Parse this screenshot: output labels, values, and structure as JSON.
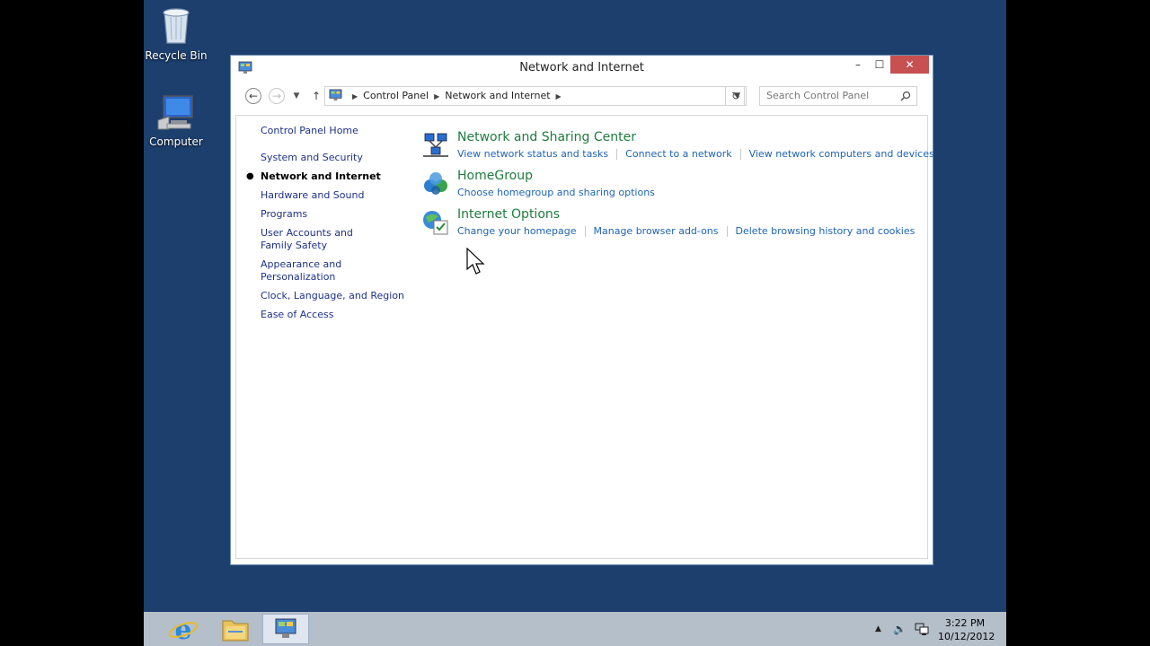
{
  "desktop": {
    "icons": [
      {
        "label": "Recycle Bin"
      },
      {
        "label": "Computer"
      }
    ]
  },
  "window": {
    "title": "Network and Internet",
    "controls": {
      "minimize": "–",
      "maximize": "☐",
      "close": "✕"
    }
  },
  "address": {
    "crumbs": [
      "Control Panel",
      "Network and Internet"
    ],
    "search_placeholder": "Search Control Panel"
  },
  "sidebar": {
    "home": "Control Panel Home",
    "items": [
      {
        "label": "System and Security"
      },
      {
        "label": "Network and Internet",
        "current": true
      },
      {
        "label": "Hardware and Sound"
      },
      {
        "label": "Programs"
      },
      {
        "label": "User Accounts and Family Safety"
      },
      {
        "label": "Appearance and Personalization"
      },
      {
        "label": "Clock, Language, and Region"
      },
      {
        "label": "Ease of Access"
      }
    ]
  },
  "tasks": [
    {
      "title": "Network and Sharing Center",
      "icon": "network-sharing-icon",
      "links": [
        "View network status and tasks",
        "Connect to a network",
        "View network computers and devices"
      ]
    },
    {
      "title": "HomeGroup",
      "icon": "homegroup-icon",
      "links": [
        "Choose homegroup and sharing options"
      ]
    },
    {
      "title": "Internet Options",
      "icon": "internet-options-icon",
      "links": [
        "Change your homepage",
        "Manage browser add-ons",
        "Delete browsing history and cookies"
      ]
    }
  ],
  "taskbar": {
    "pinned": [
      {
        "name": "internet-explorer-icon"
      },
      {
        "name": "file-explorer-icon"
      },
      {
        "name": "control-panel-icon",
        "active": true
      }
    ],
    "clock": {
      "time": "3:22 PM",
      "date": "10/12/2012"
    }
  },
  "colors": {
    "desktop": "#1c3f6e",
    "link": "#1e64b4",
    "task_title": "#1e7c3e",
    "close_button": "#c75050"
  }
}
